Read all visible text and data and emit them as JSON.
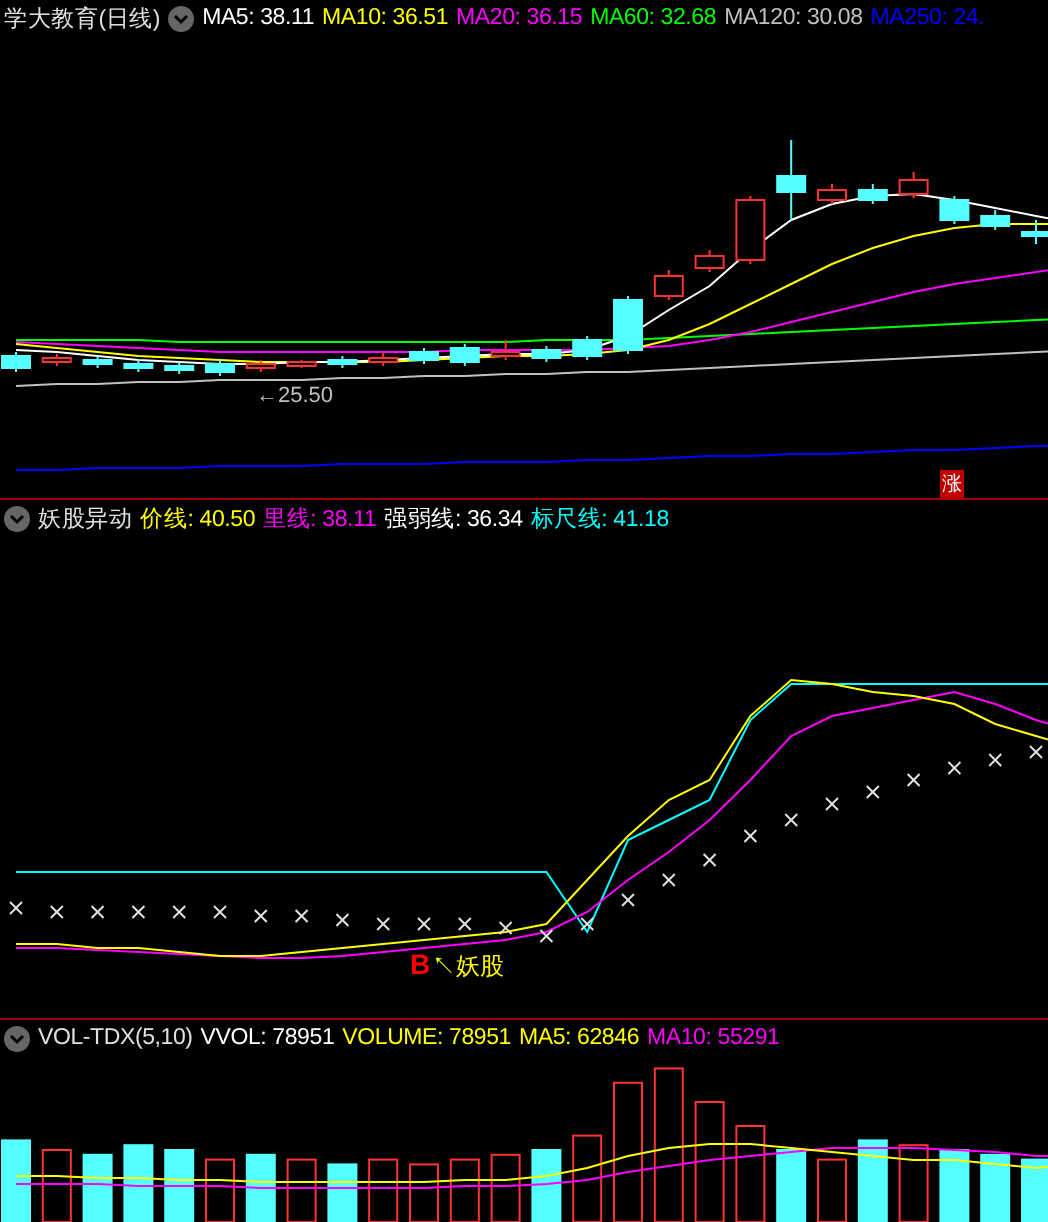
{
  "main_panel": {
    "title": "学大教育(日线)",
    "legend": [
      {
        "text": "MA5: 38.11",
        "color": "#ffffff"
      },
      {
        "text": "MA10: 36.51",
        "color": "#ffff00"
      },
      {
        "text": "MA20: 36.15",
        "color": "#ff00ff"
      },
      {
        "text": "MA60: 32.68",
        "color": "#00ff00"
      },
      {
        "text": "MA120: 30.08",
        "color": "#c0c0c0"
      },
      {
        "text": "MA250: 24.",
        "color": "#0000ff"
      }
    ],
    "low_marker": "←25.50",
    "rise_badge": "涨"
  },
  "indicator_panel": {
    "title": "妖股异动",
    "legend": [
      {
        "text": "价线: 40.50",
        "color": "#ffff00"
      },
      {
        "text": "里线: 38.11",
        "color": "#ff00ff"
      },
      {
        "text": "强弱线: 36.34",
        "color": "#ffffff"
      },
      {
        "text": "标尺线: 41.18",
        "color": "#00ffff"
      }
    ],
    "buy_mark": "B",
    "signal_label": "↖妖股"
  },
  "volume_panel": {
    "title": "VOL-TDX(5,10)",
    "legend": [
      {
        "text": "VVOL: 78951",
        "color": "#ffffff"
      },
      {
        "text": "VOLUME: 78951",
        "color": "#ffff00"
      },
      {
        "text": "MA5: 62846",
        "color": "#ffff00"
      },
      {
        "text": "MA10: 55291",
        "color": "#ff00ff"
      }
    ]
  }
}
